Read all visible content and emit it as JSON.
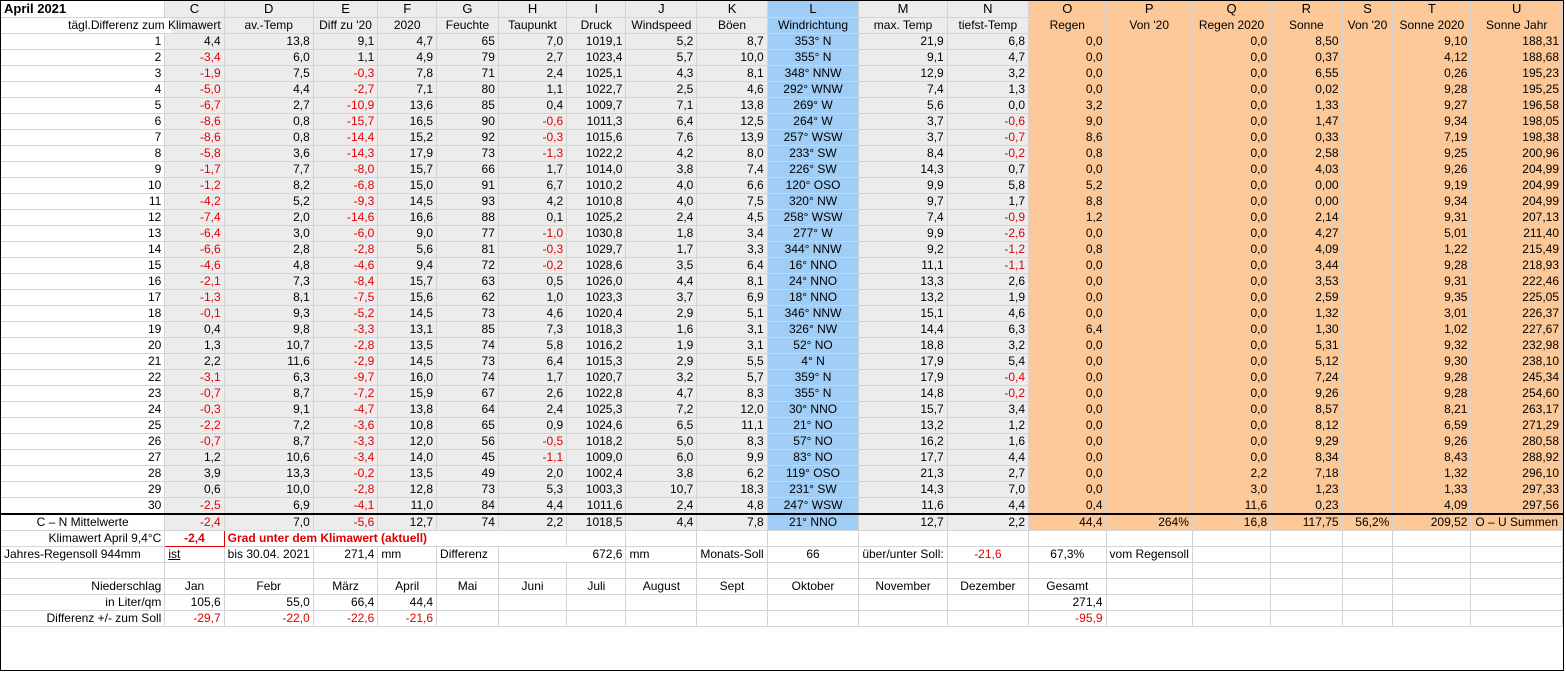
{
  "title": "April 2021",
  "letters": [
    "C",
    "D",
    "E",
    "F",
    "G",
    "H",
    "I",
    "J",
    "K",
    "L",
    "M",
    "N",
    "O",
    "P",
    "Q",
    "R",
    "S",
    "T",
    "U"
  ],
  "header2": [
    "tägl.Differenz zum Klimawert",
    "av.-Temp",
    "Diff zu '20",
    "2020",
    "Feuchte",
    "Taupunkt",
    "Druck",
    "Windspeed",
    "Böen",
    "Windrichtung",
    "max. Temp",
    "tiefst-Temp",
    "Regen",
    "Von '20",
    "Regen 2020",
    "Sonne",
    "Von '20",
    "Sonne 2020",
    "Sonne Jahr"
  ],
  "rows": [
    [
      "1",
      "4,4",
      "13,8",
      "9,1",
      "4,7",
      "65",
      "7,0",
      "1019,1",
      "5,2",
      "8,7",
      "353° N",
      "21,9",
      "6,8",
      "0,0",
      "",
      "0,0",
      "8,50",
      "",
      "9,10",
      "188,31"
    ],
    [
      "2",
      "-3,4",
      "6,0",
      "1,1",
      "4,9",
      "79",
      "2,7",
      "1023,4",
      "5,7",
      "10,0",
      "355° N",
      "9,1",
      "4,7",
      "0,0",
      "",
      "0,0",
      "0,37",
      "",
      "4,12",
      "188,68"
    ],
    [
      "3",
      "-1,9",
      "7,5",
      "-0,3",
      "7,8",
      "71",
      "2,4",
      "1025,1",
      "4,3",
      "8,1",
      "348° NNW",
      "12,9",
      "3,2",
      "0,0",
      "",
      "0,0",
      "6,55",
      "",
      "0,26",
      "195,23"
    ],
    [
      "4",
      "-5,0",
      "4,4",
      "-2,7",
      "7,1",
      "80",
      "1,1",
      "1022,7",
      "2,5",
      "4,6",
      "292° WNW",
      "7,4",
      "1,3",
      "0,0",
      "",
      "0,0",
      "0,02",
      "",
      "9,28",
      "195,25"
    ],
    [
      "5",
      "-6,7",
      "2,7",
      "-10,9",
      "13,6",
      "85",
      "0,4",
      "1009,7",
      "7,1",
      "13,8",
      "269° W",
      "5,6",
      "0,0",
      "3,2",
      "",
      "0,0",
      "1,33",
      "",
      "9,27",
      "196,58"
    ],
    [
      "6",
      "-8,6",
      "0,8",
      "-15,7",
      "16,5",
      "90",
      "-0,6",
      "1011,3",
      "6,4",
      "12,5",
      "264° W",
      "3,7",
      "-0,6",
      "9,0",
      "",
      "0,0",
      "1,47",
      "",
      "9,34",
      "198,05"
    ],
    [
      "7",
      "-8,6",
      "0,8",
      "-14,4",
      "15,2",
      "92",
      "-0,3",
      "1015,6",
      "7,6",
      "13,9",
      "257° WSW",
      "3,7",
      "-0,7",
      "8,6",
      "",
      "0,0",
      "0,33",
      "",
      "7,19",
      "198,38"
    ],
    [
      "8",
      "-5,8",
      "3,6",
      "-14,3",
      "17,9",
      "73",
      "-1,3",
      "1022,2",
      "4,2",
      "8,0",
      "233° SW",
      "8,4",
      "-0,2",
      "0,8",
      "",
      "0,0",
      "2,58",
      "",
      "9,25",
      "200,96"
    ],
    [
      "9",
      "-1,7",
      "7,7",
      "-8,0",
      "15,7",
      "66",
      "1,7",
      "1014,0",
      "3,8",
      "7,4",
      "226° SW",
      "14,3",
      "0,7",
      "0,0",
      "",
      "0,0",
      "4,03",
      "",
      "9,26",
      "204,99"
    ],
    [
      "10",
      "-1,2",
      "8,2",
      "-6,8",
      "15,0",
      "91",
      "6,7",
      "1010,2",
      "4,0",
      "6,6",
      "120° OSO",
      "9,9",
      "5,8",
      "5,2",
      "",
      "0,0",
      "0,00",
      "",
      "9,19",
      "204,99"
    ],
    [
      "11",
      "-4,2",
      "5,2",
      "-9,3",
      "14,5",
      "93",
      "4,2",
      "1010,8",
      "4,0",
      "7,5",
      "320° NW",
      "9,7",
      "1,7",
      "8,8",
      "",
      "0,0",
      "0,00",
      "",
      "9,34",
      "204,99"
    ],
    [
      "12",
      "-7,4",
      "2,0",
      "-14,6",
      "16,6",
      "88",
      "0,1",
      "1025,2",
      "2,4",
      "4,5",
      "258° WSW",
      "7,4",
      "-0,9",
      "1,2",
      "",
      "0,0",
      "2,14",
      "",
      "9,31",
      "207,13"
    ],
    [
      "13",
      "-6,4",
      "3,0",
      "-6,0",
      "9,0",
      "77",
      "-1,0",
      "1030,8",
      "1,8",
      "3,4",
      "277° W",
      "9,9",
      "-2,6",
      "0,0",
      "",
      "0,0",
      "4,27",
      "",
      "5,01",
      "211,40"
    ],
    [
      "14",
      "-6,6",
      "2,8",
      "-2,8",
      "5,6",
      "81",
      "-0,3",
      "1029,7",
      "1,7",
      "3,3",
      "344° NNW",
      "9,2",
      "-1,2",
      "0,8",
      "",
      "0,0",
      "4,09",
      "",
      "1,22",
      "215,49"
    ],
    [
      "15",
      "-4,6",
      "4,8",
      "-4,6",
      "9,4",
      "72",
      "-0,2",
      "1028,6",
      "3,5",
      "6,4",
      "16° NNO",
      "11,1",
      "-1,1",
      "0,0",
      "",
      "0,0",
      "3,44",
      "",
      "9,28",
      "218,93"
    ],
    [
      "16",
      "-2,1",
      "7,3",
      "-8,4",
      "15,7",
      "63",
      "0,5",
      "1026,0",
      "4,4",
      "8,1",
      "24° NNO",
      "13,3",
      "2,6",
      "0,0",
      "",
      "0,0",
      "3,53",
      "",
      "9,31",
      "222,46"
    ],
    [
      "17",
      "-1,3",
      "8,1",
      "-7,5",
      "15,6",
      "62",
      "1,0",
      "1023,3",
      "3,7",
      "6,9",
      "18° NNO",
      "13,2",
      "1,9",
      "0,0",
      "",
      "0,0",
      "2,59",
      "",
      "9,35",
      "225,05"
    ],
    [
      "18",
      "-0,1",
      "9,3",
      "-5,2",
      "14,5",
      "73",
      "4,6",
      "1020,4",
      "2,9",
      "5,1",
      "346° NNW",
      "15,1",
      "4,6",
      "0,0",
      "",
      "0,0",
      "1,32",
      "",
      "3,01",
      "226,37"
    ],
    [
      "19",
      "0,4",
      "9,8",
      "-3,3",
      "13,1",
      "85",
      "7,3",
      "1018,3",
      "1,6",
      "3,1",
      "326° NW",
      "14,4",
      "6,3",
      "6,4",
      "",
      "0,0",
      "1,30",
      "",
      "1,02",
      "227,67"
    ],
    [
      "20",
      "1,3",
      "10,7",
      "-2,8",
      "13,5",
      "74",
      "5,8",
      "1016,2",
      "1,9",
      "3,1",
      "52° NO",
      "18,8",
      "3,2",
      "0,0",
      "",
      "0,0",
      "5,31",
      "",
      "9,32",
      "232,98"
    ],
    [
      "21",
      "2,2",
      "11,6",
      "-2,9",
      "14,5",
      "73",
      "6,4",
      "1015,3",
      "2,9",
      "5,5",
      "4° N",
      "17,9",
      "5,4",
      "0,0",
      "",
      "0,0",
      "5,12",
      "",
      "9,30",
      "238,10"
    ],
    [
      "22",
      "-3,1",
      "6,3",
      "-9,7",
      "16,0",
      "74",
      "1,7",
      "1020,7",
      "3,2",
      "5,7",
      "359° N",
      "17,9",
      "-0,4",
      "0,0",
      "",
      "0,0",
      "7,24",
      "",
      "9,28",
      "245,34"
    ],
    [
      "23",
      "-0,7",
      "8,7",
      "-7,2",
      "15,9",
      "67",
      "2,6",
      "1022,8",
      "4,7",
      "8,3",
      "355° N",
      "14,8",
      "-0,2",
      "0,0",
      "",
      "0,0",
      "9,26",
      "",
      "9,28",
      "254,60"
    ],
    [
      "24",
      "-0,3",
      "9,1",
      "-4,7",
      "13,8",
      "64",
      "2,4",
      "1025,3",
      "7,2",
      "12,0",
      "30° NNO",
      "15,7",
      "3,4",
      "0,0",
      "",
      "0,0",
      "8,57",
      "",
      "8,21",
      "263,17"
    ],
    [
      "25",
      "-2,2",
      "7,2",
      "-3,6",
      "10,8",
      "65",
      "0,9",
      "1024,6",
      "6,5",
      "11,1",
      "21° NO",
      "13,2",
      "1,2",
      "0,0",
      "",
      "0,0",
      "8,12",
      "",
      "6,59",
      "271,29"
    ],
    [
      "26",
      "-0,7",
      "8,7",
      "-3,3",
      "12,0",
      "56",
      "-0,5",
      "1018,2",
      "5,0",
      "8,3",
      "57° NO",
      "16,2",
      "1,6",
      "0,0",
      "",
      "0,0",
      "9,29",
      "",
      "9,26",
      "280,58"
    ],
    [
      "27",
      "1,2",
      "10,6",
      "-3,4",
      "14,0",
      "45",
      "-1,1",
      "1009,0",
      "6,0",
      "9,9",
      "83° NO",
      "17,7",
      "4,4",
      "0,0",
      "",
      "0,0",
      "8,34",
      "",
      "8,43",
      "288,92"
    ],
    [
      "28",
      "3,9",
      "13,3",
      "-0,2",
      "13,5",
      "49",
      "2,0",
      "1002,4",
      "3,8",
      "6,2",
      "119° OSO",
      "21,3",
      "2,7",
      "0,0",
      "",
      "2,2",
      "7,18",
      "",
      "1,32",
      "296,10"
    ],
    [
      "29",
      "0,6",
      "10,0",
      "-2,8",
      "12,8",
      "73",
      "5,3",
      "1003,3",
      "10,7",
      "18,3",
      "231° SW",
      "14,3",
      "7,0",
      "0,0",
      "",
      "3,0",
      "1,23",
      "",
      "1,33",
      "297,33"
    ],
    [
      "30",
      "-2,5",
      "6,9",
      "-4,1",
      "11,0",
      "84",
      "4,4",
      "1011,6",
      "2,4",
      "4,8",
      "247° WSW",
      "11,6",
      "4,4",
      "0,4",
      "",
      "11,6",
      "0,23",
      "",
      "4,09",
      "297,56"
    ]
  ],
  "summary": [
    "C – N Mittelwerte",
    "-2,4",
    "7,0",
    "-5,6",
    "12,7",
    "74",
    "2,2",
    "1018,5",
    "4,4",
    "7,8",
    "21° NNO",
    "12,7",
    "2,2",
    "44,4",
    "264%",
    "16,8",
    "117,75",
    "56,2%",
    "209,52",
    "O – U Summen"
  ],
  "klima": {
    "label": "Klimawert April 9,4°C",
    "value": "-2,4",
    "note": "Grad unter dem Klimawert (aktuell)"
  },
  "jahres": {
    "label": "Jahres-Regensoll 944mm",
    "ist": "ist",
    "bis": "bis",
    "date": "30.04. 2021",
    "value": "271,4",
    "unit": "mm",
    "diff_label": "Differenz",
    "diff_value": "672,6",
    "diff_unit": "mm",
    "monats_label": "Monats-Soll",
    "monats_value": "66",
    "ueber_label": "über/unter Soll:",
    "ueber_value": "-21,6",
    "percent": "67,3%",
    "vom": "vom Regensoll"
  },
  "months": {
    "label": "Niederschlag",
    "names": [
      "Jan",
      "Febr",
      "März",
      "April",
      "Mai",
      "Juni",
      "Juli",
      "August",
      "Sept",
      "Oktober",
      "November",
      "Dezember",
      "Gesamt"
    ]
  },
  "liter": {
    "label": "in Liter/qm",
    "values": [
      "105,6",
      "55,0",
      "66,4",
      "44,4",
      "",
      "",
      "",
      "",
      "",
      "",
      "",
      "",
      "271,4"
    ]
  },
  "diff": {
    "label": "Differenz  +/- zum Soll",
    "values": [
      "-29,7",
      "-22,0",
      "-22,6",
      "-21,6",
      "",
      "",
      "",
      "",
      "",
      "",
      "",
      "",
      "-95,9"
    ]
  }
}
